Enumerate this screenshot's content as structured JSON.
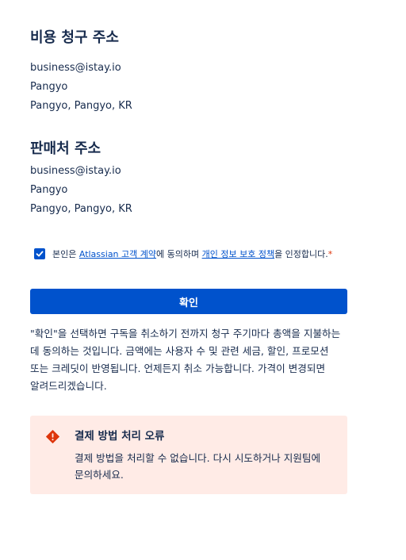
{
  "billing_address": {
    "title": "비용 청구 주소",
    "email": "business@istay.io",
    "line1": "Pangyo",
    "line2": "Pangyo, Pangyo, KR"
  },
  "seller_address": {
    "title": "판매처 주소",
    "email": "business@istay.io",
    "line1": "Pangyo",
    "line2": "Pangyo, Pangyo, KR"
  },
  "consent": {
    "checked": true,
    "prefix": "본인은 ",
    "agreement_link": "Atlassian 고객 계약",
    "middle": "에 동의하며 ",
    "privacy_link": "개인 정보 보호 정책",
    "suffix": "을 인정합니다.",
    "required_mark": "*"
  },
  "confirm_button": {
    "label": "확인"
  },
  "disclaimer": "\"확인\"을 선택하면 구독을 취소하기 전까지 청구 주기마다 총액을 지불하는 데 동의하는 것입니다. 금액에는 사용자 수 및 관련 세금, 할인, 프로모션 또는 크레딧이 반영됩니다. 언제든지 취소 가능합니다. 가격이 변경되면 알려드리겠습니다.",
  "error": {
    "icon": "error-icon",
    "title": "결제 방법 처리 오류",
    "message": "결제 방법을 처리할 수 없습니다. 다시 시도하거나 지원팀에 문의하세요.",
    "color": "#de350b",
    "background": "#ffebe6"
  },
  "colors": {
    "primary": "#0052cc",
    "text": "#172b4d"
  }
}
